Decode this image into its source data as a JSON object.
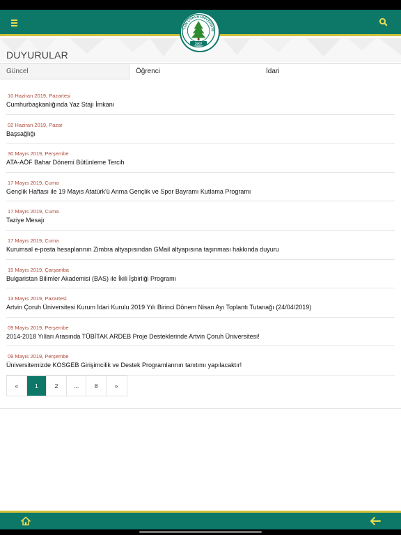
{
  "colors": {
    "primary": "#0d7768",
    "accent": "#d2c23a",
    "date": "#b04a3a",
    "icon": "#e8dd55"
  },
  "header": {
    "menu_icon": "menu-icon",
    "search_icon": "search-icon",
    "logo": {
      "text_top": "ARTVİN ÇORUH ÜNİVERSİTESİ",
      "year": "2007"
    }
  },
  "page_title": "DUYURULAR",
  "tabs": [
    {
      "label": "Güncel",
      "active": true
    },
    {
      "label": "Öğrenci",
      "active": false
    },
    {
      "label": "İdari",
      "active": false
    }
  ],
  "announcements": [
    {
      "date": "10 Haziran 2019, Pazartesi",
      "title": "Cumhurbaşkanlığında Yaz Stajı İmkanı"
    },
    {
      "date": "02 Haziran 2019, Pazar",
      "title": "Başsağlığı"
    },
    {
      "date": "30 Mayıs 2019, Perşembe",
      "title": "ATA-AÖF Bahar Dönemi Bütünleme Tercih"
    },
    {
      "date": "17 Mayıs 2019, Cuma",
      "title": "Gençlik Haftası ile 19 Mayıs Atatürk'ü Anma Gençlik ve Spor Bayramı Kutlama Programı"
    },
    {
      "date": "17 Mayıs 2019, Cuma",
      "title": "Taziye Mesajı"
    },
    {
      "date": "17 Mayıs 2019, Cuma",
      "title": "Kurumsal e-posta hesaplarının Zimbra altyapısından GMail altyapısına taşınması hakkında duyuru"
    },
    {
      "date": "15 Mayıs 2019, Çarşamba",
      "title": "Bulgaristan Bilimler Akademisi (BAS) ile İkili İşbirliği Programı"
    },
    {
      "date": "13 Mayıs 2019, Pazartesi",
      "title": "Artvin Çoruh Üniversitesi Kurum İdari Kurulu 2019 Yılı Birinci Dönem Nisan Ayı Toplantı Tutanağı (24/04/2019)"
    },
    {
      "date": "09 Mayıs 2019, Perşembe",
      "title": "2014-2018 Yılları Arasında TÜBİTAK ARDEB Proje Desteklerinde Artvin Çoruh Üniversitesi!"
    },
    {
      "date": "09 Mayıs 2019, Perşembe",
      "title": "Üniversitemizde KOSGEB Girişimcilik ve Destek Programlarının tanıtımı yapılacaktır!"
    }
  ],
  "pagination": {
    "prev": "«",
    "pages": [
      "1",
      "2",
      "...",
      "8"
    ],
    "next": "»",
    "current": "1"
  },
  "footer": {
    "home_icon": "home-icon",
    "back_icon": "back-arrow-icon"
  }
}
